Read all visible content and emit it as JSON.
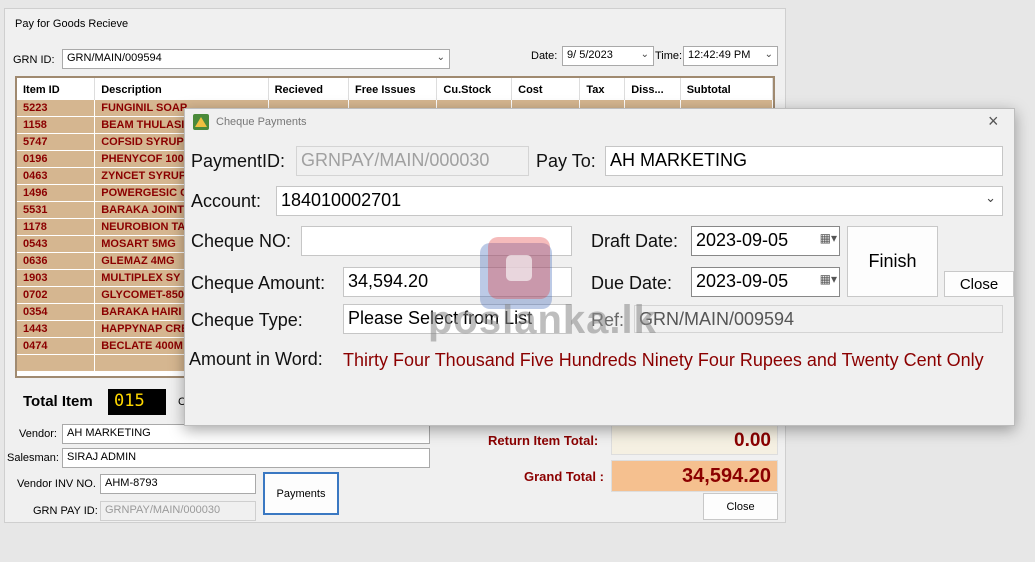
{
  "main": {
    "title": "Pay for Goods Recieve",
    "grn_label": "GRN ID:",
    "grn_value": "GRN/MAIN/009594",
    "date_label": "Date:",
    "date_value": "9/  5/2023",
    "time_label": "Time:",
    "time_value": "12:42:49 PM",
    "columns": [
      "Item ID",
      "Description",
      "Recieved",
      "Free Issues",
      "Cu.Stock",
      "Cost",
      "Tax",
      "Diss...",
      "Subtotal"
    ],
    "rows": [
      [
        "5223",
        "FUNGINIL SOAP"
      ],
      [
        "1158",
        "BEAM THULASI"
      ],
      [
        "5747",
        "COFSID SYRUP"
      ],
      [
        "0196",
        "PHENYCOF 100"
      ],
      [
        "0463",
        "ZYNCET SYRUP"
      ],
      [
        "1496",
        "POWERGESIC G"
      ],
      [
        "5531",
        "BARAKA JOINT"
      ],
      [
        "1178",
        "NEUROBION TA"
      ],
      [
        "0543",
        "MOSART 5MG"
      ],
      [
        "0636",
        "GLEMAZ 4MG"
      ],
      [
        "1903",
        "MULTIPLEX SY"
      ],
      [
        "0702",
        "GLYCOMET-850"
      ],
      [
        "0354",
        "BARAKA HAIRI"
      ],
      [
        "1443",
        "HAPPYNAP CRE"
      ],
      [
        "0474",
        "BECLATE 400M"
      ]
    ],
    "total_item_label": "Total Item",
    "total_item_value": "015",
    "vendor_label": "Vendor:",
    "vendor_value": "AH MARKETING",
    "salesman_label": "Salesman:",
    "salesman_value": "SIRAJ ADMIN",
    "vendor_inv_label": "Vendor INV NO.",
    "vendor_inv_value": "AHM-8793",
    "grn_pay_label": "GRN PAY ID:",
    "grn_pay_value": "GRNPAY/MAIN/000030",
    "payments_button": "Payments",
    "return_total_label": "Return Item Total:",
    "return_total_value": "0.00",
    "grand_total_label": "Grand Total :",
    "grand_total_value": "34,594.20",
    "close_button": "Close"
  },
  "dialog": {
    "title": "Cheque Payments",
    "payment_id_label": "PaymentID:",
    "payment_id_value": "GRNPAY/MAIN/000030",
    "pay_to_label": "Pay To:",
    "pay_to_value": "AH MARKETING",
    "account_label": "Account:",
    "account_value": "184010002701",
    "cheque_no_label": "Cheque NO:",
    "cheque_no_value": "",
    "draft_date_label": "Draft Date:",
    "draft_date_value": "2023-09-05",
    "cheque_amount_label": "Cheque Amount:",
    "cheque_amount_value": "34,594.20",
    "due_date_label": "Due Date:",
    "due_date_value": "2023-09-05",
    "cheque_type_label": "Cheque Type:",
    "cheque_type_value": "Please Select from List",
    "ref_label": "Ref:",
    "ref_value": "GRN/MAIN/009594",
    "amount_word_label": "Amount in Word:",
    "amount_word_value": "Thirty Four Thousand Five Hundreds Ninety Four Rupees and Twenty  Cent Only",
    "finish_button": "Finish",
    "close_button": "Close"
  },
  "watermark": "poslanka.lk",
  "colors": {
    "row_bg": "#d5b690",
    "row_text": "#8b0000",
    "grand_total_bg": "#f5c08f",
    "return_total_bg": "#f5f0e2",
    "total_item_bg": "#000000",
    "total_item_fg": "#ffd800"
  }
}
